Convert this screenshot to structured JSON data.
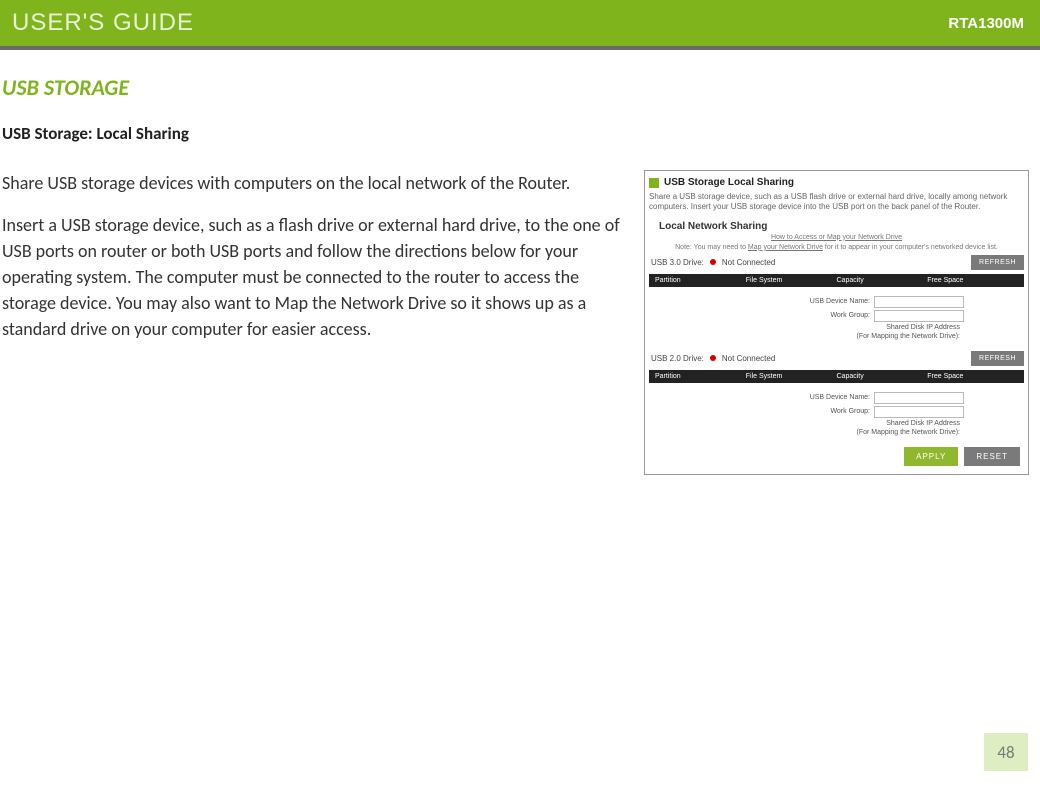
{
  "header": {
    "left": "USER'S GUIDE",
    "right": "RTA1300M"
  },
  "section_title": "USB STORAGE",
  "subtitle": "USB Storage: Local Sharing",
  "para1": "Share USB storage devices with computers on the local network of the Router.",
  "para2": "Insert a USB storage device, such as a flash drive or external hard drive, to the one of USB ports on router or both USB ports and follow the directions below for your operating system.  The computer must be connected to the router to access the storage device.  You may also want to Map the Network Drive so it shows up as a standard drive on your computer for easier access.",
  "panel": {
    "title": "USB Storage Local Sharing",
    "desc": "Share a USB storage device, such as a USB flash drive or external hard drive, locally among network computers. Insert your USB storage device into the USB port on the back panel of the Router.",
    "sub_head": "Local Network Sharing",
    "note_pre": "How to Access or Map your Network Drive",
    "note_line": "Note: You may need to ",
    "note_link": "Map your Network Drive",
    "note_suf": " for it to appear in your computer's networked device list.",
    "usb3_label": "USB 3.0 Drive:",
    "usb2_label": "USB 2.0 Drive:",
    "not_connected": "Not Connected",
    "refresh": "REFRESH",
    "th_partition": "Partition",
    "th_fs": "File System",
    "th_cap": "Capacity",
    "th_free": "Free Space",
    "f_device": "USB Device Name:",
    "f_workgroup": "Work Group:",
    "f_ip1": "Shared Disk IP Address",
    "f_ip2": "(For Mapping the Network Drive):",
    "apply": "APPLY",
    "reset": "RESET"
  },
  "page_num": "48"
}
